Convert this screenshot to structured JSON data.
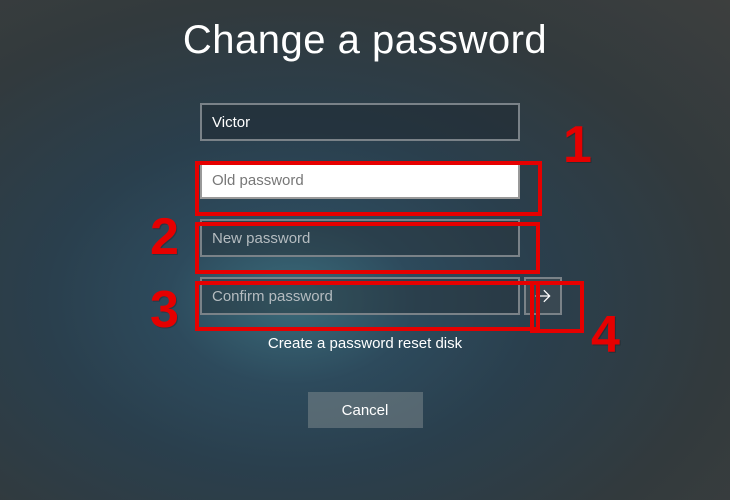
{
  "title": "Change a password",
  "username": "Victor",
  "fields": {
    "old_password": {
      "placeholder": "Old password",
      "value": ""
    },
    "new_password": {
      "placeholder": "New password",
      "value": ""
    },
    "confirm_password": {
      "placeholder": "Confirm password",
      "value": ""
    }
  },
  "reset_link": "Create a password reset disk",
  "cancel_label": "Cancel",
  "annotations": {
    "1": "1",
    "2": "2",
    "3": "3",
    "4": "4"
  }
}
